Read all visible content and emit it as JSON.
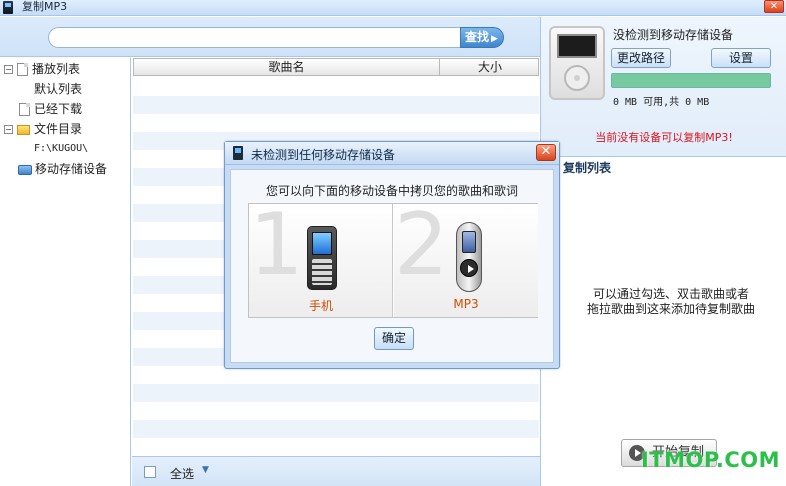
{
  "window": {
    "title": "复制MP3",
    "close_label": "✕"
  },
  "search": {
    "value": "",
    "placeholder": "",
    "button_label": "查找",
    "button_arrow": "▶"
  },
  "tree": {
    "items": [
      {
        "label": "播放列表",
        "toggle": "−"
      },
      {
        "label": "默认列表"
      },
      {
        "label": "已经下载"
      },
      {
        "label": "文件目录",
        "toggle": "−"
      },
      {
        "label": "F:\\KUGOU\\"
      },
      {
        "label": "移动存储设备"
      }
    ]
  },
  "songlist": {
    "columns": [
      "歌曲名",
      "大小"
    ],
    "rows": []
  },
  "bottom": {
    "select_all_label": "全选",
    "caret": "▼"
  },
  "device": {
    "status": "没检测到移动存储设备",
    "change_path_label": "更改路径",
    "settings_label": "设置",
    "capacity_text": "0 MB 可用,共 0 MB",
    "capacity_fill_fraction": 1.0,
    "capacity_color": "#77c9a0",
    "no_device_warning": "当前没有设备可以复制MP3!",
    "warning_color": "#d8141e"
  },
  "copylist": {
    "title": "复制列表",
    "hint_line1": "可以通过勾选、双击歌曲或者",
    "hint_line2": "拖拉歌曲到这来添加待复制歌曲",
    "start_label": "开始复制"
  },
  "dialog": {
    "title": "未检测到任何移动存储设备",
    "close_label": "✕",
    "message": "您可以向下面的移动设备中拷贝您的歌曲和歌词",
    "options": [
      {
        "number": "1",
        "label": "手机"
      },
      {
        "number": "2",
        "label": "MP3"
      }
    ],
    "ok_label": "确定"
  },
  "watermark": "ITMOP.COM",
  "colors": {
    "accent_blue": "#3e86cf",
    "panel_bg": "#dcebfb",
    "option_label": "#d24d00",
    "watermark_green": "#2cc04a"
  }
}
